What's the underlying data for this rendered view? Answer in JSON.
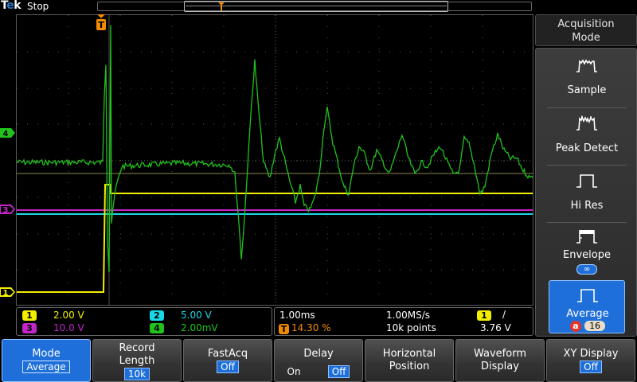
{
  "topbar": {
    "brand_t": "T",
    "brand_e": "e",
    "brand_k": "k",
    "run_state": "Stop"
  },
  "markers": {
    "trigger": "T",
    "ch1": "1",
    "ch3": "3",
    "ch4": "4"
  },
  "readout": {
    "channels": [
      {
        "num": "1",
        "scale": "2.00 V",
        "color": "#f2ee00"
      },
      {
        "num": "2",
        "scale": "5.00 V",
        "color": "#18d8e6"
      },
      {
        "num": "3",
        "scale": "10.0 V",
        "color": "#c225c8"
      },
      {
        "num": "4",
        "scale": "2.00mV",
        "color": "#21c21c"
      }
    ],
    "timebase": "1.00ms",
    "sample_rate": "1.00MS/s",
    "trigger_pos_icon": "T",
    "trigger_pos": "14.30 %",
    "record_points": "10k points",
    "trigger_source": "1",
    "trigger_slope": "/",
    "trigger_level": "3.76 V"
  },
  "side_menu": {
    "title_line1": "Acquisition",
    "title_line2": "Mode",
    "items": [
      {
        "label": "Sample",
        "icon": "sample-waveform-icon"
      },
      {
        "label": "Peak Detect",
        "icon": "peak-detect-waveform-icon"
      },
      {
        "label": "Hi Res",
        "icon": "hi-res-waveform-icon"
      },
      {
        "label": "Envelope",
        "icon": "envelope-waveform-icon",
        "value": "∞"
      },
      {
        "label": "Average",
        "icon": "average-waveform-icon",
        "knob": "a",
        "value": "16",
        "selected": true
      }
    ]
  },
  "bottom_menu": [
    {
      "line1": "Mode",
      "value": "Average",
      "selected": true
    },
    {
      "line1": "Record",
      "line2": "Length",
      "value": "10k"
    },
    {
      "line1": "FastAcq",
      "value": "Off"
    },
    {
      "line1": "Delay",
      "opt_on": "On",
      "opt_off": "Off"
    },
    {
      "line1": "Horizontal",
      "line2": "Position"
    },
    {
      "line1": "Waveform",
      "line2": "Display"
    },
    {
      "line1": "XY Display",
      "value": "Off"
    }
  ],
  "colors": {
    "ch1": "#f2ee00",
    "ch2": "#18d8e6",
    "ch3": "#c225c8",
    "ch4": "#21c21c",
    "trigger": "#f08a00",
    "accent": "#1e6fd9"
  }
}
